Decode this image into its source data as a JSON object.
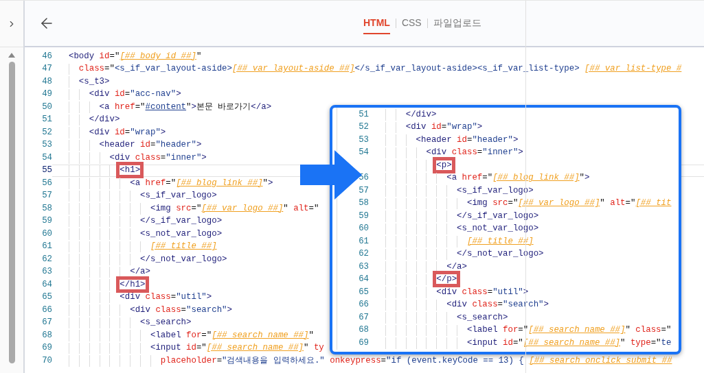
{
  "tabs": [
    {
      "label": "HTML",
      "selected": true
    },
    {
      "label": "CSS",
      "selected": false
    },
    {
      "label": "파일업로드",
      "selected": false
    }
  ],
  "editor": {
    "lines": [
      {
        "number": "46",
        "current": false,
        "tokens": [
          {
            "kind": "tag",
            "text": "<body"
          },
          {
            "kind": "attr",
            "text": " id"
          },
          {
            "kind": "text",
            "text": "=\""
          },
          {
            "kind": "var",
            "text": "[##_body_id_##]"
          },
          {
            "kind": "text",
            "text": "\""
          }
        ]
      },
      {
        "number": "47",
        "current": false,
        "tokens": [
          {
            "kind": "attr",
            "text": "  class"
          },
          {
            "kind": "text",
            "text": "=\""
          },
          {
            "kind": "string",
            "text": "<s_if_var_layout-aside>"
          },
          {
            "kind": "var",
            "text": "[##_var_layout-aside_##]"
          },
          {
            "kind": "string",
            "text": "</s_if_var_layout-aside><s_if_var_list-type> "
          },
          {
            "kind": "var",
            "text": "[##_var_list-type_#"
          }
        ]
      },
      {
        "number": "48",
        "current": false,
        "tokens": [
          {
            "kind": "tag",
            "text": "  <s_t3>"
          }
        ]
      },
      {
        "number": "49",
        "current": false,
        "tokens": [
          {
            "kind": "tag",
            "text": "    <div"
          },
          {
            "kind": "attr",
            "text": " id"
          },
          {
            "kind": "text",
            "text": "="
          },
          {
            "kind": "string",
            "text": "\"acc-nav\""
          },
          {
            "kind": "tag",
            "text": ">"
          }
        ]
      },
      {
        "number": "50",
        "current": false,
        "tokens": [
          {
            "kind": "tag",
            "text": "      <a"
          },
          {
            "kind": "attr",
            "text": " href"
          },
          {
            "kind": "text",
            "text": "=\""
          },
          {
            "kind": "link",
            "text": "#content"
          },
          {
            "kind": "text",
            "text": "\""
          },
          {
            "kind": "tag",
            "text": ">"
          },
          {
            "kind": "text",
            "text": "본문 바로가기"
          },
          {
            "kind": "tag",
            "text": "</a>"
          }
        ]
      },
      {
        "number": "51",
        "current": false,
        "tokens": [
          {
            "kind": "tag",
            "text": "    </div>"
          }
        ]
      },
      {
        "number": "52",
        "current": false,
        "tokens": [
          {
            "kind": "tag",
            "text": "    <div"
          },
          {
            "kind": "attr",
            "text": " id"
          },
          {
            "kind": "text",
            "text": "="
          },
          {
            "kind": "string",
            "text": "\"wrap\""
          },
          {
            "kind": "tag",
            "text": ">"
          }
        ]
      },
      {
        "number": "53",
        "current": false,
        "tokens": [
          {
            "kind": "tag",
            "text": "      <header"
          },
          {
            "kind": "attr",
            "text": " id"
          },
          {
            "kind": "text",
            "text": "="
          },
          {
            "kind": "string",
            "text": "\"header\""
          },
          {
            "kind": "tag",
            "text": ">"
          }
        ]
      },
      {
        "number": "54",
        "current": false,
        "tokens": [
          {
            "kind": "tag",
            "text": "        <div"
          },
          {
            "kind": "attr",
            "text": " class"
          },
          {
            "kind": "text",
            "text": "="
          },
          {
            "kind": "string",
            "text": "\"inner\""
          },
          {
            "kind": "tag",
            "text": ">"
          }
        ]
      },
      {
        "number": "55",
        "current": true,
        "tokens": [
          {
            "kind": "tag",
            "text": "          <h1>",
            "marked": true
          }
        ]
      },
      {
        "number": "56",
        "current": false,
        "tokens": [
          {
            "kind": "tag",
            "text": "            <a"
          },
          {
            "kind": "attr",
            "text": " href"
          },
          {
            "kind": "text",
            "text": "=\""
          },
          {
            "kind": "var",
            "text": "[##_blog_link_##]"
          },
          {
            "kind": "text",
            "text": "\""
          },
          {
            "kind": "tag",
            "text": ">"
          }
        ]
      },
      {
        "number": "57",
        "current": false,
        "tokens": [
          {
            "kind": "tag",
            "text": "              <s_if_var_logo>"
          }
        ]
      },
      {
        "number": "58",
        "current": false,
        "tokens": [
          {
            "kind": "tag",
            "text": "                <img"
          },
          {
            "kind": "attr",
            "text": " src"
          },
          {
            "kind": "text",
            "text": "=\""
          },
          {
            "kind": "var",
            "text": "[##_var_logo_##]"
          },
          {
            "kind": "text",
            "text": "\""
          },
          {
            "kind": "attr",
            "text": " alt"
          },
          {
            "kind": "text",
            "text": "=\""
          }
        ]
      },
      {
        "number": "59",
        "current": false,
        "tokens": [
          {
            "kind": "tag",
            "text": "              </s_if_var_logo>"
          }
        ]
      },
      {
        "number": "60",
        "current": false,
        "tokens": [
          {
            "kind": "tag",
            "text": "              <s_not_var_logo>"
          }
        ]
      },
      {
        "number": "61",
        "current": false,
        "tokens": [
          {
            "kind": "var",
            "text": "                [##_title_##]"
          }
        ]
      },
      {
        "number": "62",
        "current": false,
        "tokens": [
          {
            "kind": "tag",
            "text": "              </s_not_var_logo>"
          }
        ]
      },
      {
        "number": "63",
        "current": false,
        "tokens": [
          {
            "kind": "tag",
            "text": "            </a>"
          }
        ]
      },
      {
        "number": "64",
        "current": false,
        "tokens": [
          {
            "kind": "tag",
            "text": "          </h1>",
            "marked": true
          }
        ]
      },
      {
        "number": "65",
        "current": false,
        "tokens": [
          {
            "kind": "tag",
            "text": "          <div"
          },
          {
            "kind": "attr",
            "text": " class"
          },
          {
            "kind": "text",
            "text": "="
          },
          {
            "kind": "string",
            "text": "\"util\""
          },
          {
            "kind": "tag",
            "text": ">"
          }
        ]
      },
      {
        "number": "66",
        "current": false,
        "tokens": [
          {
            "kind": "tag",
            "text": "            <div"
          },
          {
            "kind": "attr",
            "text": " class"
          },
          {
            "kind": "text",
            "text": "="
          },
          {
            "kind": "string",
            "text": "\"search\""
          },
          {
            "kind": "tag",
            "text": ">"
          }
        ]
      },
      {
        "number": "67",
        "current": false,
        "tokens": [
          {
            "kind": "tag",
            "text": "              <s_search>"
          }
        ]
      },
      {
        "number": "68",
        "current": false,
        "tokens": [
          {
            "kind": "tag",
            "text": "                <label"
          },
          {
            "kind": "attr",
            "text": " for"
          },
          {
            "kind": "text",
            "text": "=\""
          },
          {
            "kind": "var",
            "text": "[##_search_name_##]"
          },
          {
            "kind": "text",
            "text": "\""
          }
        ]
      },
      {
        "number": "69",
        "current": false,
        "tokens": [
          {
            "kind": "tag",
            "text": "                <input"
          },
          {
            "kind": "attr",
            "text": " id"
          },
          {
            "kind": "text",
            "text": "=\""
          },
          {
            "kind": "var",
            "text": "[##_search_name_##]"
          },
          {
            "kind": "text",
            "text": "\""
          },
          {
            "kind": "attr",
            "text": " ty"
          }
        ]
      },
      {
        "number": "70",
        "current": false,
        "tokens": [
          {
            "kind": "attr",
            "text": "                  placeholder"
          },
          {
            "kind": "text",
            "text": "="
          },
          {
            "kind": "string",
            "text": "\"검색내용을 입력하세요.\""
          },
          {
            "kind": "attr",
            "text": " onkeypress"
          },
          {
            "kind": "text",
            "text": "="
          },
          {
            "kind": "string",
            "text": "\"if (event.keyCode == 13) { "
          },
          {
            "kind": "var",
            "text": "[##_search_onclick_submit_##"
          }
        ]
      }
    ]
  },
  "zoom_callout": {
    "lines": [
      {
        "number": "51",
        "current": false,
        "tokens": [
          {
            "kind": "tag",
            "text": "    </div>"
          }
        ]
      },
      {
        "number": "52",
        "current": false,
        "tokens": [
          {
            "kind": "tag",
            "text": "    <div"
          },
          {
            "kind": "attr",
            "text": " id"
          },
          {
            "kind": "text",
            "text": "="
          },
          {
            "kind": "string",
            "text": "\"wrap\""
          },
          {
            "kind": "tag",
            "text": ">"
          }
        ]
      },
      {
        "number": "53",
        "current": false,
        "tokens": [
          {
            "kind": "tag",
            "text": "      <header"
          },
          {
            "kind": "attr",
            "text": " id"
          },
          {
            "kind": "text",
            "text": "="
          },
          {
            "kind": "string",
            "text": "\"header\""
          },
          {
            "kind": "tag",
            "text": ">"
          }
        ]
      },
      {
        "number": "54",
        "current": false,
        "tokens": [
          {
            "kind": "tag",
            "text": "        <div"
          },
          {
            "kind": "attr",
            "text": " class"
          },
          {
            "kind": "text",
            "text": "="
          },
          {
            "kind": "string",
            "text": "\"inner\""
          },
          {
            "kind": "tag",
            "text": ">"
          }
        ]
      },
      {
        "current": false,
        "tokens": [
          {
            "kind": "tag",
            "text": "          <p>",
            "marked": true
          }
        ]
      },
      {
        "number": "56",
        "current": false,
        "tokens": [
          {
            "kind": "tag",
            "text": "            <a"
          },
          {
            "kind": "attr",
            "text": " href"
          },
          {
            "kind": "text",
            "text": "=\""
          },
          {
            "kind": "var",
            "text": "[##_blog_link_##]"
          },
          {
            "kind": "text",
            "text": "\""
          },
          {
            "kind": "tag",
            "text": ">"
          }
        ]
      },
      {
        "number": "57",
        "current": false,
        "tokens": [
          {
            "kind": "tag",
            "text": "              <s_if_var_logo>"
          }
        ]
      },
      {
        "number": "58",
        "current": false,
        "tokens": [
          {
            "kind": "tag",
            "text": "                <img"
          },
          {
            "kind": "attr",
            "text": " src"
          },
          {
            "kind": "text",
            "text": "=\""
          },
          {
            "kind": "var",
            "text": "[##_var_logo_##]"
          },
          {
            "kind": "text",
            "text": "\""
          },
          {
            "kind": "attr",
            "text": " alt"
          },
          {
            "kind": "text",
            "text": "=\""
          },
          {
            "kind": "var",
            "text": "[##_tit"
          }
        ]
      },
      {
        "number": "59",
        "current": false,
        "tokens": [
          {
            "kind": "tag",
            "text": "              </s_if_var_logo>"
          }
        ]
      },
      {
        "number": "60",
        "current": false,
        "tokens": [
          {
            "kind": "tag",
            "text": "              <s_not_var_logo>"
          }
        ]
      },
      {
        "number": "61",
        "current": false,
        "tokens": [
          {
            "kind": "var",
            "text": "                [##_title_##]"
          }
        ]
      },
      {
        "number": "62",
        "current": false,
        "tokens": [
          {
            "kind": "tag",
            "text": "              </s_not_var_logo>"
          }
        ]
      },
      {
        "number": "63",
        "current": false,
        "tokens": [
          {
            "kind": "tag",
            "text": "            </a>"
          }
        ]
      },
      {
        "number": "64",
        "current": false,
        "tokens": [
          {
            "kind": "tag",
            "text": "          </p>",
            "marked": true
          }
        ]
      },
      {
        "number": "65",
        "current": false,
        "tokens": [
          {
            "kind": "tag",
            "text": "          <div"
          },
          {
            "kind": "attr",
            "text": " class"
          },
          {
            "kind": "text",
            "text": "="
          },
          {
            "kind": "string",
            "text": "\"util\""
          },
          {
            "kind": "tag",
            "text": ">"
          }
        ]
      },
      {
        "number": "66",
        "current": false,
        "tokens": [
          {
            "kind": "tag",
            "text": "            <div"
          },
          {
            "kind": "attr",
            "text": " class"
          },
          {
            "kind": "text",
            "text": "="
          },
          {
            "kind": "string",
            "text": "\"search\""
          },
          {
            "kind": "tag",
            "text": ">"
          }
        ]
      },
      {
        "number": "67",
        "current": false,
        "tokens": [
          {
            "kind": "tag",
            "text": "              <s_search>"
          }
        ]
      },
      {
        "number": "68",
        "current": false,
        "tokens": [
          {
            "kind": "tag",
            "text": "                <label"
          },
          {
            "kind": "attr",
            "text": " for"
          },
          {
            "kind": "text",
            "text": "=\""
          },
          {
            "kind": "var",
            "text": "[##_search_name_##]"
          },
          {
            "kind": "text",
            "text": "\""
          },
          {
            "kind": "attr",
            "text": " class"
          },
          {
            "kind": "text",
            "text": "=\""
          }
        ]
      },
      {
        "number": "69",
        "current": false,
        "tokens": [
          {
            "kind": "tag",
            "text": "                <input"
          },
          {
            "kind": "attr",
            "text": " id"
          },
          {
            "kind": "text",
            "text": "=\""
          },
          {
            "kind": "var",
            "text": "[##_search_name_##]"
          },
          {
            "kind": "text",
            "text": "\""
          },
          {
            "kind": "attr",
            "text": " type"
          },
          {
            "kind": "text",
            "text": "=\""
          },
          {
            "kind": "string",
            "text": "te"
          }
        ]
      }
    ]
  }
}
